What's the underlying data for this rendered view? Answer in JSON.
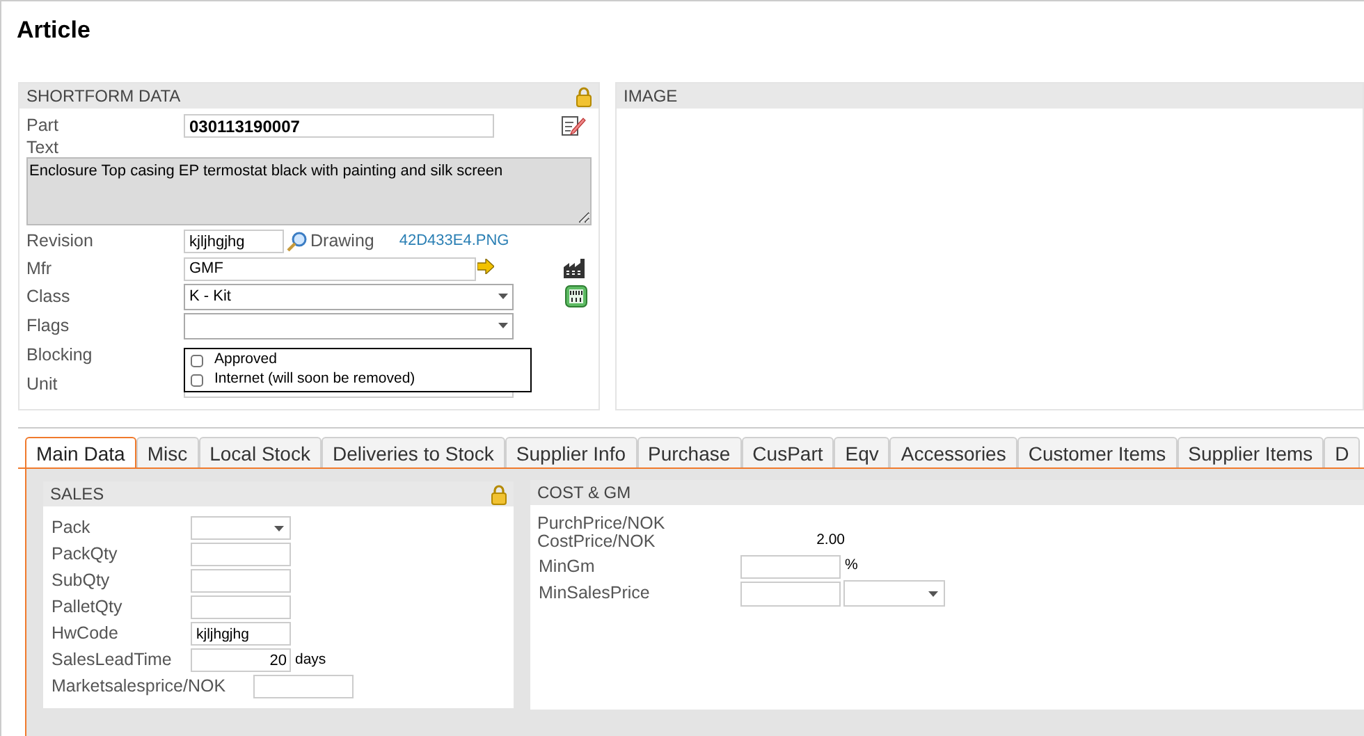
{
  "page_title": "Article",
  "shortform": {
    "title": "SHORTFORM DATA",
    "part": {
      "label": "Part",
      "value": "030113190007"
    },
    "text": {
      "label": "Text",
      "value": "Enclosure Top casing EP termostat black with painting and silk screen"
    },
    "revision": {
      "label": "Revision",
      "value": "kjljhgjhg",
      "drawing_label": "Drawing",
      "file": "42D433E4.PNG"
    },
    "mfr": {
      "label": "Mfr",
      "value": "GMF"
    },
    "class": {
      "label": "Class",
      "value": "K - Kit"
    },
    "flags": {
      "label": "Flags",
      "expanded": true,
      "options": [
        {
          "label": "Approved",
          "checked": false
        },
        {
          "label": "Internet (will soon be removed)",
          "checked": false
        }
      ]
    },
    "blocking": {
      "label": "Blocking"
    },
    "unit": {
      "label": "Unit"
    }
  },
  "image": {
    "title": "IMAGE"
  },
  "tabs": [
    {
      "label": "Main Data",
      "selected": true
    },
    {
      "label": "Misc",
      "selected": false
    },
    {
      "label": "Local Stock",
      "selected": false
    },
    {
      "label": "Deliveries to Stock",
      "selected": false
    },
    {
      "label": "Supplier Info",
      "selected": false
    },
    {
      "label": "Purchase",
      "selected": false
    },
    {
      "label": "CusPart",
      "selected": false
    },
    {
      "label": "Eqv",
      "selected": false
    },
    {
      "label": "Accessories",
      "selected": false
    },
    {
      "label": "Customer Items",
      "selected": false
    },
    {
      "label": "Supplier Items",
      "selected": false
    },
    {
      "label": "D",
      "selected": false
    }
  ],
  "sales": {
    "title": "SALES",
    "fields": [
      {
        "kind": "select",
        "label": "Pack"
      },
      {
        "kind": "input",
        "label": "PackQty"
      },
      {
        "kind": "input",
        "label": "SubQty"
      },
      {
        "kind": "input",
        "label": "PalletQty"
      },
      {
        "kind": "input",
        "label": "HwCode",
        "value": "kjljhgjhg"
      },
      {
        "kind": "unit",
        "label": "SalesLeadTime",
        "value": "20",
        "unit": "days"
      },
      {
        "kind": "wide",
        "label": "Marketsalesprice/NOK"
      }
    ]
  },
  "cost": {
    "title": "COST & GM",
    "purch_label": "PurchPrice/NOK",
    "cost_label": "CostPrice/NOK",
    "cost_value": "2.00",
    "min_gm": {
      "label": "MinGm",
      "unit": "%"
    },
    "min_sales": {
      "label": "MinSalesPrice"
    }
  }
}
